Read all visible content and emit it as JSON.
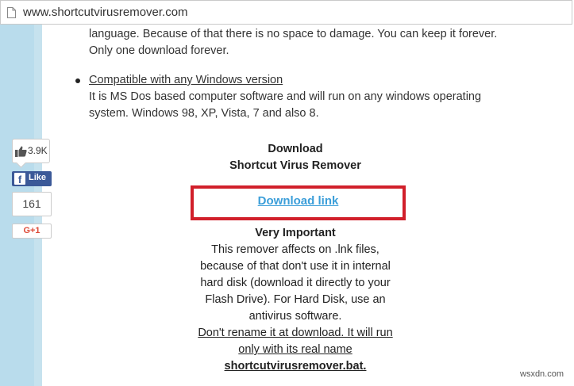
{
  "browser": {
    "url": "www.shortcutvirusremover.com"
  },
  "intro": {
    "line1": "language. Because of that there is no space to damage. You can keep it forever.",
    "line2": "Only one download forever."
  },
  "feature": {
    "title": "Compatible with any Windows version",
    "line1": "It is MS Dos based computer software and will run on any windows operating",
    "line2": "system. Windows 98, XP, Vista, 7 and also 8."
  },
  "download": {
    "heading": "Download",
    "subheading": "Shortcut Virus Remover",
    "link_label": "Download link"
  },
  "important": {
    "heading": "Very Important",
    "line1": "This remover affects on .lnk files,",
    "line2": "because of that don't use it in internal",
    "line3": "hard disk (download it directly to your",
    "line4": "Flash Drive). For Hard Disk, use an",
    "line5": "antivirus software.",
    "warn1": "Don't rename it at download. It will run",
    "warn2": "only with its real name",
    "filename": "shortcutvirusremover.bat."
  },
  "social": {
    "like_count": "3.9K",
    "fb_label": "Like",
    "fb_f": "f",
    "plus_count": "161",
    "gplus_label": "G+1"
  },
  "watermark": "wsxdn.com",
  "colors": {
    "highlight_box": "#d11f2a",
    "link": "#3b9ed9",
    "facebook": "#3b5998",
    "gplus": "#dd4b39"
  }
}
